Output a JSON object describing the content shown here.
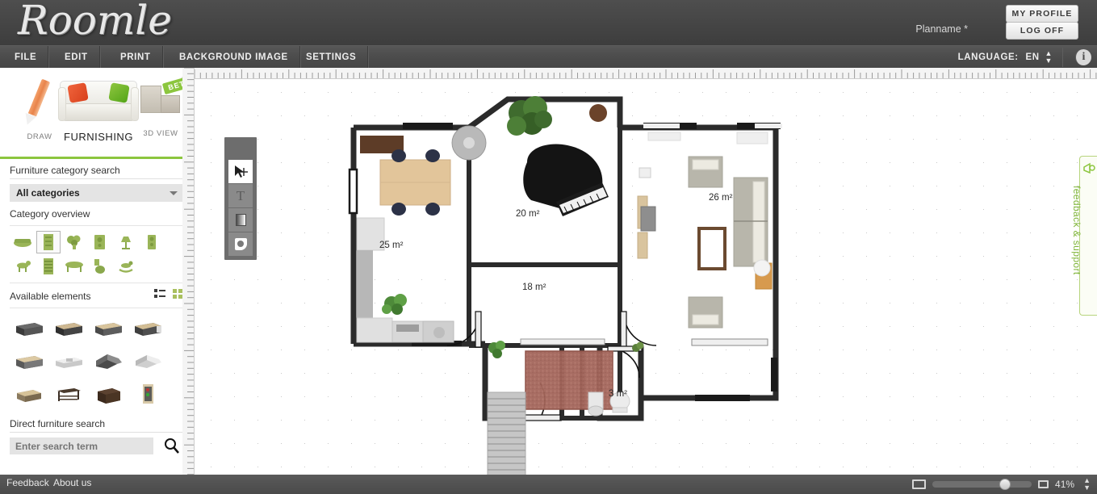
{
  "header": {
    "logo_text": "Roomle",
    "plan_name": "Planname *",
    "profile_button": "MY PROFILE",
    "logoff_button": "LOG OFF"
  },
  "menu": {
    "items": [
      {
        "label": "FILE",
        "name": "menu-file"
      },
      {
        "label": "EDIT",
        "name": "menu-edit"
      },
      {
        "label": "PRINT",
        "name": "menu-print"
      },
      {
        "label": "BACKGROUND IMAGE",
        "name": "menu-background-image"
      },
      {
        "label": "SETTINGS",
        "name": "menu-settings"
      }
    ],
    "language_label": "LANGUAGE:",
    "language_value": "EN",
    "info_icon": "info-icon"
  },
  "sidebar": {
    "modes": [
      {
        "label": "DRAW",
        "name": "mode-draw",
        "active": false
      },
      {
        "label": "FURNISHING",
        "name": "mode-furnishing",
        "active": true
      },
      {
        "label": "3D VIEW",
        "name": "mode-3dview",
        "active": false,
        "badge": "BETA"
      }
    ],
    "category_search_label": "Furniture category search",
    "category_select_value": "All categories",
    "category_overview_label": "Category overview",
    "categories": [
      {
        "name": "category-sofa",
        "icon": "sofa-icon",
        "selected": false
      },
      {
        "name": "category-shelf",
        "icon": "shelf-icon",
        "selected": true
      },
      {
        "name": "category-plant",
        "icon": "plant-icon",
        "selected": false
      },
      {
        "name": "category-speaker",
        "icon": "speaker-icon",
        "selected": false
      },
      {
        "name": "category-lamp",
        "icon": "lamp-icon",
        "selected": false
      },
      {
        "name": "category-tower",
        "icon": "tower-speaker-icon",
        "selected": false
      },
      {
        "name": "category-pet",
        "icon": "dog-icon",
        "selected": false
      },
      {
        "name": "category-bookcase",
        "icon": "bookcase-icon",
        "selected": false
      },
      {
        "name": "category-table",
        "icon": "table-icon",
        "selected": false
      },
      {
        "name": "category-toilet",
        "icon": "toilet-icon",
        "selected": false
      },
      {
        "name": "category-rockinghorse",
        "icon": "rocking-horse-icon",
        "selected": false
      }
    ],
    "available_elements_label": "Available elements",
    "view_list_icon": "list-view-icon",
    "view_grid_icon": "grid-view-icon",
    "elements": [
      {
        "name": "element-sideboard-dark"
      },
      {
        "name": "element-sideboard-open"
      },
      {
        "name": "element-sideboard-wood"
      },
      {
        "name": "element-cabinet-drawers"
      },
      {
        "name": "element-sideboard-light"
      },
      {
        "name": "element-shelf-white"
      },
      {
        "name": "element-corner-unit"
      },
      {
        "name": "element-corner-shelf"
      },
      {
        "name": "element-dresser-oak"
      },
      {
        "name": "element-console-table"
      },
      {
        "name": "element-cabinet-brown"
      },
      {
        "name": "element-tall-cabinet"
      }
    ],
    "direct_search_label": "Direct furniture search",
    "search_placeholder": "Enter search term",
    "search_value": "",
    "search_icon": "magnifier-icon"
  },
  "toolbar": {
    "tools": [
      {
        "name": "tool-select-move",
        "icon": "cursor-move-icon",
        "active": true
      },
      {
        "name": "tool-text",
        "icon": "text-icon",
        "label": "T",
        "active": false
      },
      {
        "name": "tool-rectangle",
        "icon": "rectangle-icon",
        "active": false
      },
      {
        "name": "tool-stamp",
        "icon": "stamp-icon",
        "active": false
      }
    ]
  },
  "floorplan": {
    "rooms": [
      {
        "name": "room-dining-kitchen",
        "area": "25 m²"
      },
      {
        "name": "room-music",
        "area": "20 m²"
      },
      {
        "name": "room-living",
        "area": "26 m²"
      },
      {
        "name": "room-hallway",
        "area": "18 m²"
      },
      {
        "name": "room-bathroom",
        "area": "3 m²"
      }
    ]
  },
  "footer": {
    "feedback_link": "Feedback",
    "about_link": "About us",
    "zoom_value": "41%",
    "fullscreen_icon": "screen-large-icon",
    "fit_icon": "screen-small-icon"
  },
  "feedback_tab": {
    "label": "feedback & support",
    "icon": "megaphone-icon"
  }
}
